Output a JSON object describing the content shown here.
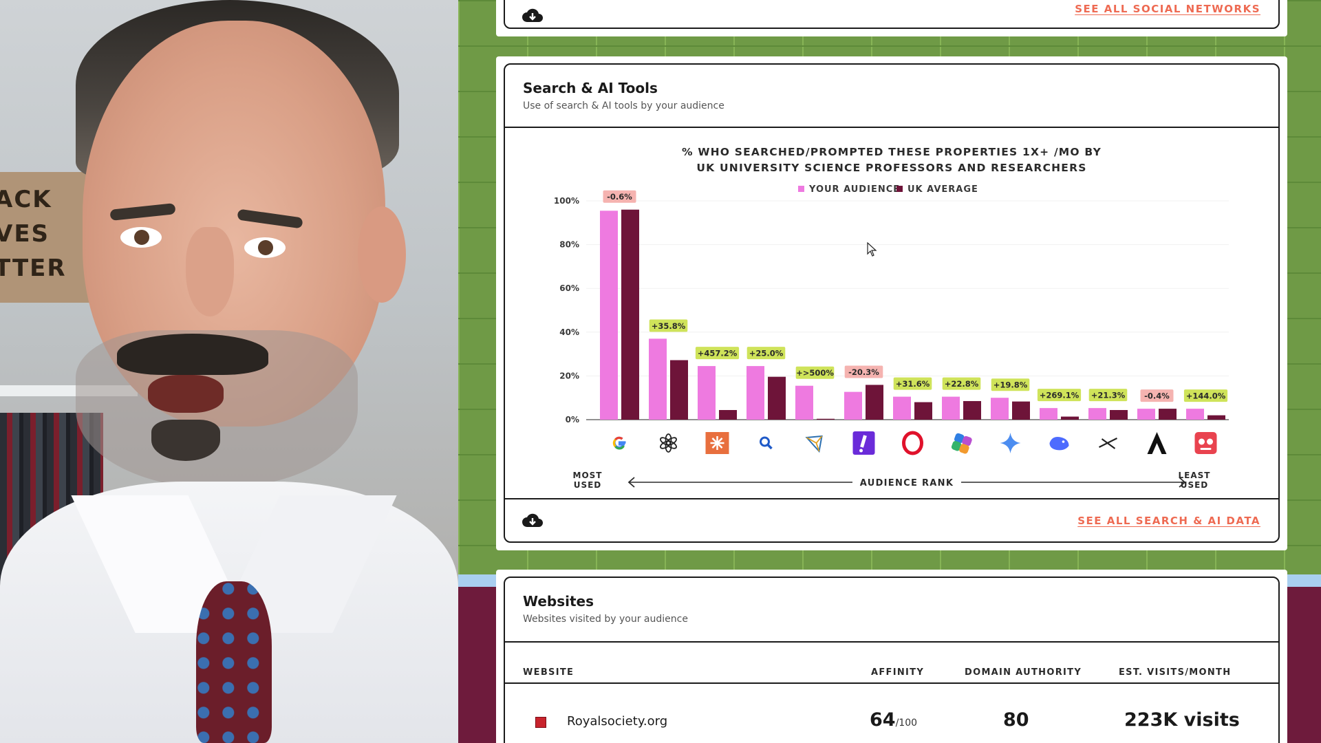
{
  "social_card": {
    "see_all_label": "SEE ALL SOCIAL NETWORKS",
    "download_icon": "cloud-download-icon"
  },
  "search_card": {
    "title": "Search & AI Tools",
    "subtitle": "Use of search & AI tools by your audience",
    "see_all_label": "SEE ALL SEARCH & AI DATA",
    "download_icon": "cloud-download-icon"
  },
  "websites_card": {
    "title": "Websites",
    "subtitle": "Websites visited by your audience",
    "columns": [
      "WEBSITE",
      "AFFINITY",
      "DOMAIN AUTHORITY",
      "EST. VISITS/MONTH"
    ],
    "rows": [
      {
        "site": "Royalsociety.org",
        "affinity": "64",
        "affinity_suffix": "/100",
        "domain_authority": "80",
        "visits": "223K visits"
      }
    ]
  },
  "chart_data": {
    "type": "bar",
    "title_lines": [
      "% WHO SEARCHED/PROMPTED THESE PROPERTIES 1X+ /MO BY",
      "UK UNIVERSITY SCIENCE PROFESSORS AND RESEARCHERS"
    ],
    "legend_position": "top-center",
    "ylim": [
      0,
      100
    ],
    "y_ticks": [
      "0%",
      "20%",
      "40%",
      "60%",
      "80%",
      "100%"
    ],
    "categories": [
      "Google",
      "ChatGPT",
      "Claude",
      "Bing",
      "Perplexity",
      "Yahoo",
      "Opera",
      "Copilot",
      "Gemini",
      "DeepSeek",
      "Grok",
      "Poe",
      "Character AI"
    ],
    "category_icons": [
      "google-icon",
      "chatgpt-icon",
      "claude-icon",
      "search-icon",
      "perplexity-icon",
      "yahoo-icon",
      "opera-icon",
      "copilot-icon",
      "gemini-icon",
      "deepseek-icon",
      "grok-icon",
      "poe-icon",
      "character-ai-icon"
    ],
    "series": [
      {
        "name": "YOUR AUDIENCE",
        "color": "#ee7ae0",
        "values": [
          95.5,
          37,
          24.5,
          24.5,
          15.5,
          12.7,
          10.5,
          10.5,
          10,
          5.3,
          5.3,
          5,
          5
        ]
      },
      {
        "name": "UK AVERAGE",
        "color": "#6e1439",
        "values": [
          96,
          27.2,
          4.4,
          19.6,
          0.4,
          15.9,
          8,
          8.5,
          8.3,
          1.4,
          4.4,
          5,
          2
        ]
      }
    ],
    "data_labels": [
      "-0.6%",
      "+35.8%",
      "+457.2%",
      "+25.0%",
      "+>500%",
      "-20.3%",
      "+31.6%",
      "+22.8%",
      "+19.8%",
      "+269.1%",
      "+21.3%",
      "-0.4%",
      "+144.0%"
    ],
    "x_axis": {
      "left_label": [
        "MOST",
        "USED"
      ],
      "center_label": "AUDIENCE RANK",
      "right_label": [
        "LEAST",
        "USED"
      ]
    },
    "positive_label_color": "#cfe35a",
    "negative_label_color": "#f5b3b0"
  }
}
